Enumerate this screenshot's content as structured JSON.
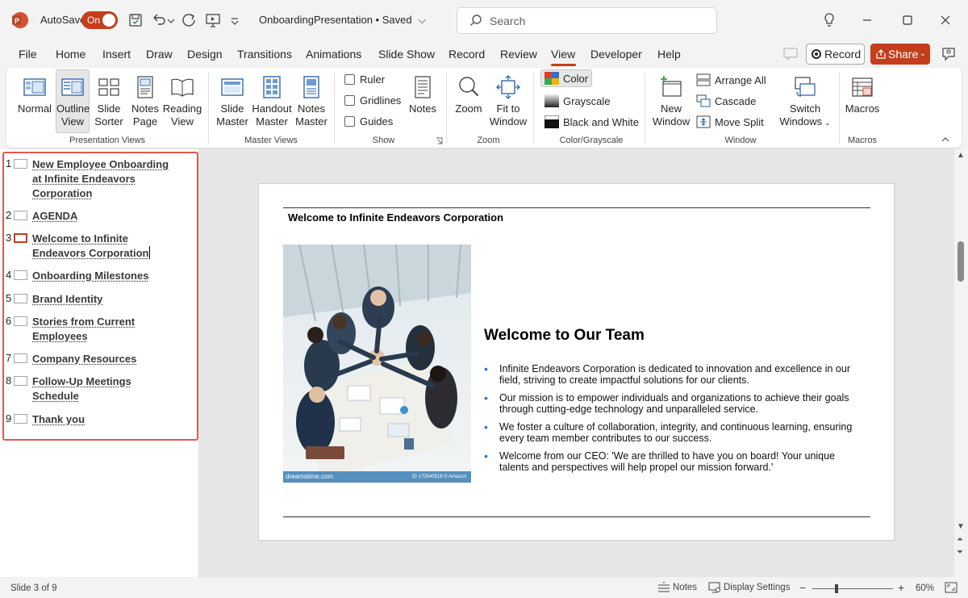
{
  "titlebar": {
    "autosave_label": "AutoSave",
    "autosave_state": "On",
    "document_title": "OnboardingPresentation • Saved",
    "search_placeholder": "Search"
  },
  "tabs": [
    "File",
    "Home",
    "Insert",
    "Draw",
    "Design",
    "Transitions",
    "Animations",
    "Slide Show",
    "Record",
    "Review",
    "View",
    "Developer",
    "Help"
  ],
  "active_tab": "View",
  "record_label": "Record",
  "share_label": "Share",
  "ribbon": {
    "presentation_views": {
      "label": "Presentation Views",
      "buttons": [
        "Normal",
        "Outline",
        "View",
        "Slide",
        "Sorter",
        "Notes",
        "Page",
        "Reading",
        "View"
      ]
    },
    "master_views": {
      "label": "Master Views",
      "buttons": [
        "Slide",
        "Master",
        "Handout",
        "Master",
        "Notes",
        "Master"
      ]
    },
    "show": {
      "label": "Show",
      "checks": [
        "Ruler",
        "Gridlines",
        "Guides"
      ],
      "notes": "Notes"
    },
    "zoom": {
      "label": "Zoom",
      "zoom": "Zoom",
      "fit1": "Fit to",
      "fit2": "Window"
    },
    "color": {
      "label": "Color/Grayscale",
      "items": [
        "Color",
        "Grayscale",
        "Black and White"
      ]
    },
    "window": {
      "label": "Window",
      "new1": "New",
      "new2": "Window",
      "items": [
        "Arrange All",
        "Cascade",
        "Move Split"
      ],
      "switch1": "Switch",
      "switch2": "Windows"
    },
    "macros": {
      "label": "Macros",
      "button": "Macros"
    }
  },
  "outline": [
    {
      "num": "1",
      "lines": [
        "New Employee Onboarding",
        "at Infinite Endeavors",
        "Corporation"
      ]
    },
    {
      "num": "2",
      "lines": [
        "AGENDA"
      ]
    },
    {
      "num": "3",
      "lines": [
        "Welcome to Infinite",
        "Endeavors Corporation"
      ]
    },
    {
      "num": "4",
      "lines": [
        "Onboarding Milestones"
      ]
    },
    {
      "num": "5",
      "lines": [
        "Brand Identity"
      ]
    },
    {
      "num": "6",
      "lines": [
        "Stories from Current",
        "Employees"
      ]
    },
    {
      "num": "7",
      "lines": [
        "Company Resources"
      ]
    },
    {
      "num": "8",
      "lines": [
        "Follow-Up Meetings",
        "Schedule"
      ]
    },
    {
      "num": "9",
      "lines": [
        "Thank you"
      ]
    }
  ],
  "current_slide_index": 2,
  "slide": {
    "title": "Welcome to Infinite Endeavors Corporation",
    "heading": "Welcome to Our Team",
    "photo_caption_left": "dreamstime.com",
    "photo_caption_right": "ID 170540518 © Amazon",
    "bullets": [
      "Infinite Endeavors Corporation is dedicated to innovation and excellence in our field, striving to create impactful solutions for our clients.",
      "Our mission is to empower individuals and organizations to achieve their goals through cutting-edge technology and unparalleled service.",
      "We foster a culture of collaboration, integrity, and continuous learning, ensuring every team member contributes to our success.",
      "Welcome from our CEO: 'We are thrilled to have you on board! Your unique talents and perspectives will help propel our mission forward.'"
    ]
  },
  "status": {
    "slide_counter": "Slide 3 of 9",
    "notes": "Notes",
    "display_settings": "Display Settings",
    "zoom_minus": "−",
    "zoom_plus": "+",
    "zoom_level": "60%"
  },
  "colors": {
    "accent": "#c43e1c",
    "outline_highlight": "#e05a4e",
    "bullet": "#2f6fd1"
  }
}
